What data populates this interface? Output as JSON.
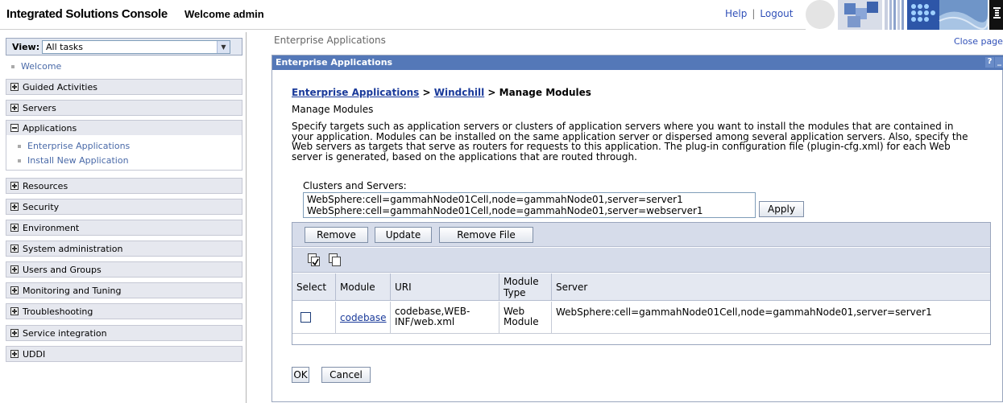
{
  "header": {
    "title": "Integrated Solutions Console",
    "welcome": "Welcome admin",
    "help": "Help",
    "separator": "|",
    "logout": "Logout"
  },
  "nav": {
    "view_label": "View:",
    "view_value": "All tasks",
    "welcome": "Welcome",
    "items": [
      {
        "label": "Guided Activities",
        "expanded": false
      },
      {
        "label": "Servers",
        "expanded": false
      },
      {
        "label": "Applications",
        "expanded": true
      },
      {
        "label": "Resources",
        "expanded": false
      },
      {
        "label": "Security",
        "expanded": false
      },
      {
        "label": "Environment",
        "expanded": false
      },
      {
        "label": "System administration",
        "expanded": false
      },
      {
        "label": "Users and Groups",
        "expanded": false
      },
      {
        "label": "Monitoring and Tuning",
        "expanded": false
      },
      {
        "label": "Troubleshooting",
        "expanded": false
      },
      {
        "label": "Service integration",
        "expanded": false
      },
      {
        "label": "UDDI",
        "expanded": false
      }
    ],
    "applications_children": [
      "Enterprise Applications",
      "Install New Application"
    ]
  },
  "main": {
    "page_title": "Enterprise Applications",
    "close_page": "Close page",
    "panel_title": "Enterprise Applications",
    "panel_help": "?",
    "panel_minimize": "_",
    "breadcrumb": {
      "link1": "Enterprise Applications",
      "sep1": " > ",
      "link2": "Windchill",
      "sep2": " > ",
      "current": "Manage Modules"
    },
    "subtitle": "Manage Modules",
    "description": "Specify targets such as application servers or clusters of application servers where you want to install the modules that are contained in your application. Modules can be installed on the same application server or dispersed among several application servers. Also, specify the Web servers as targets that serve as routers for requests to this application. The plug-in configuration file (plugin-cfg.xml) for each Web server is generated, based on the applications that are routed through.",
    "clusters_label": "Clusters and Servers:",
    "clusters": [
      "WebSphere:cell=gammahNode01Cell,node=gammahNode01,server=server1",
      "WebSphere:cell=gammahNode01Cell,node=gammahNode01,server=webserver1"
    ],
    "apply": "Apply",
    "buttons": {
      "remove": "Remove",
      "update": "Update",
      "remove_file": "Remove File"
    },
    "table": {
      "headers": [
        "Select",
        "Module",
        "URI",
        "Module Type",
        "Server"
      ],
      "rows": [
        {
          "selected": false,
          "module": "codebase",
          "uri": "codebase,WEB-INF/web.xml",
          "module_type": "Web Module",
          "server": "WebSphere:cell=gammahNode01Cell,node=gammahNode01,server=server1"
        }
      ]
    },
    "ok": "OK",
    "cancel": "Cancel"
  },
  "colors": {
    "panel_header": "#5478b8",
    "link": "#1a3a9a",
    "nav_item_bg": "#e6e8ef",
    "toolbar_bg": "#d6dcea"
  }
}
